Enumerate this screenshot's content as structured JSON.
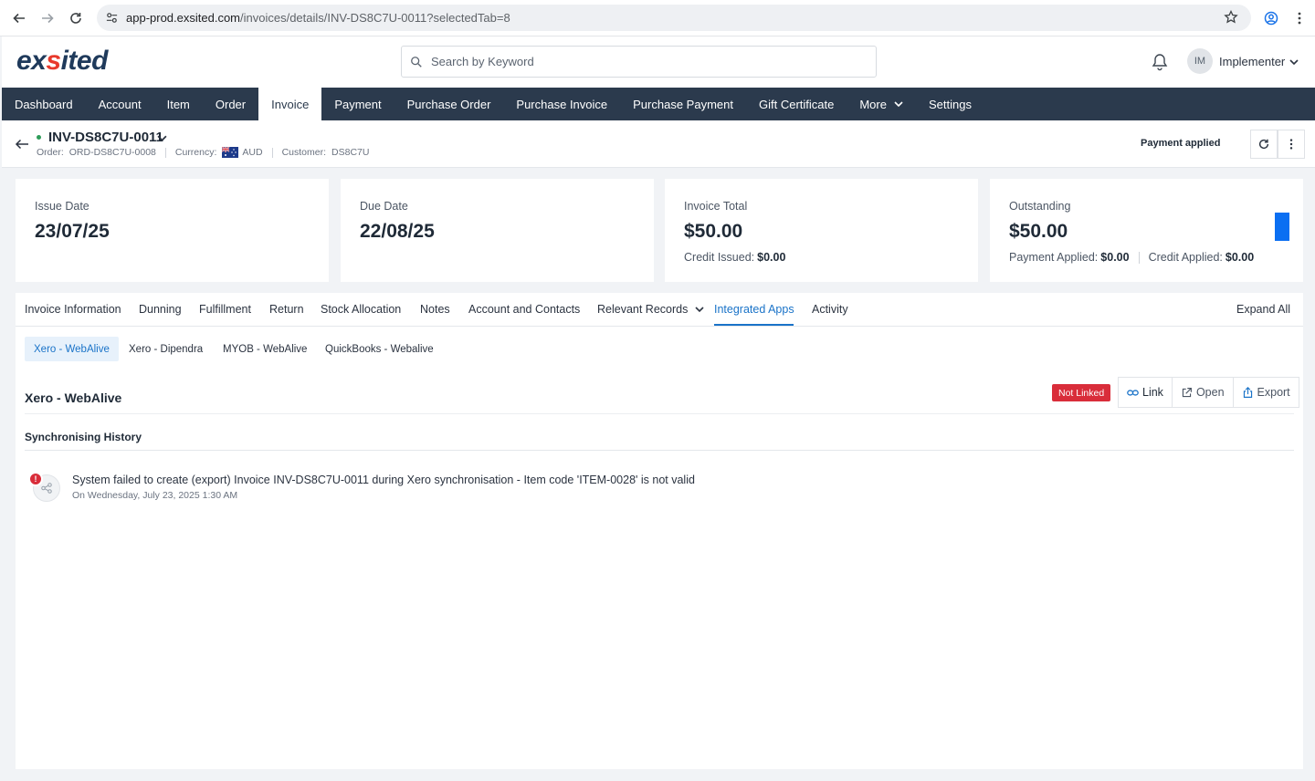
{
  "browser": {
    "url_host": "app-prod.exsited.com",
    "url_path": "/invoices/details/INV-DS8C7U-0011?selectedTab=8"
  },
  "header": {
    "logo_left": "ex",
    "logo_dot": "s",
    "logo_right": "ited",
    "search_placeholder": "Search by Keyword",
    "avatar_initials": "IM",
    "user_name": "Implementer"
  },
  "mainnav": {
    "items": [
      {
        "label": "Dashboard"
      },
      {
        "label": "Account"
      },
      {
        "label": "Item"
      },
      {
        "label": "Order"
      },
      {
        "label": "Invoice"
      },
      {
        "label": "Payment"
      },
      {
        "label": "Purchase Order"
      },
      {
        "label": "Purchase Invoice"
      },
      {
        "label": "Purchase Payment"
      },
      {
        "label": "Gift Certificate"
      },
      {
        "label": "More"
      },
      {
        "label": "Settings"
      }
    ],
    "active_index": 4
  },
  "record": {
    "title": "INV-DS8C7U-0011",
    "order_label": "Order:",
    "order_value": "ORD-DS8C7U-0008",
    "currency_label": "Currency:",
    "currency_value": "AUD",
    "customer_label": "Customer:",
    "customer_value": "DS8C7U",
    "payment_status": "Payment applied"
  },
  "cards": {
    "issue": {
      "label": "Issue Date",
      "value": "23/07/25"
    },
    "due": {
      "label": "Due Date",
      "value": "22/08/25"
    },
    "total": {
      "label": "Invoice Total",
      "value": "$50.00",
      "sub_label": "Credit Issued:",
      "sub_value": "$0.00"
    },
    "outstanding": {
      "label": "Outstanding",
      "value": "$50.00",
      "sub1_label": "Payment Applied:",
      "sub1_value": "$0.00",
      "sub2_label": "Credit Applied:",
      "sub2_value": "$0.00"
    }
  },
  "tabs": {
    "items": [
      {
        "label": "Invoice Information"
      },
      {
        "label": "Dunning"
      },
      {
        "label": "Fulfillment"
      },
      {
        "label": "Return"
      },
      {
        "label": "Stock Allocation"
      },
      {
        "label": "Notes"
      },
      {
        "label": "Account and Contacts"
      },
      {
        "label": "Relevant Records"
      },
      {
        "label": "Integrated Apps"
      },
      {
        "label": "Activity"
      }
    ],
    "active": "Integrated Apps",
    "expand_all": "Expand All"
  },
  "subtabs": {
    "items": [
      {
        "label": "Xero - WebAlive"
      },
      {
        "label": "Xero - Dipendra"
      },
      {
        "label": "MYOB - WebAlive"
      },
      {
        "label": "QuickBooks - Webalive"
      }
    ],
    "active": "Xero - WebAlive"
  },
  "integration": {
    "title": "Xero - WebAlive",
    "status_badge": "Not Linked",
    "link_label": "Link",
    "open_label": "Open",
    "export_label": "Export",
    "sync_title": "Synchronising History",
    "history": [
      {
        "message": "System failed to create (export) Invoice INV-DS8C7U-0011 during Xero synchronisation - Item code 'ITEM-0028' is not valid",
        "date": "On Wednesday, July 23, 2025 1:30 AM",
        "alert_glyph": "!"
      }
    ]
  },
  "colors": {
    "nav_bg": "#2b3a4d",
    "accent": "#1a73c8",
    "danger": "#d92d3a",
    "outstanding_flag": "#0b6ff2"
  }
}
